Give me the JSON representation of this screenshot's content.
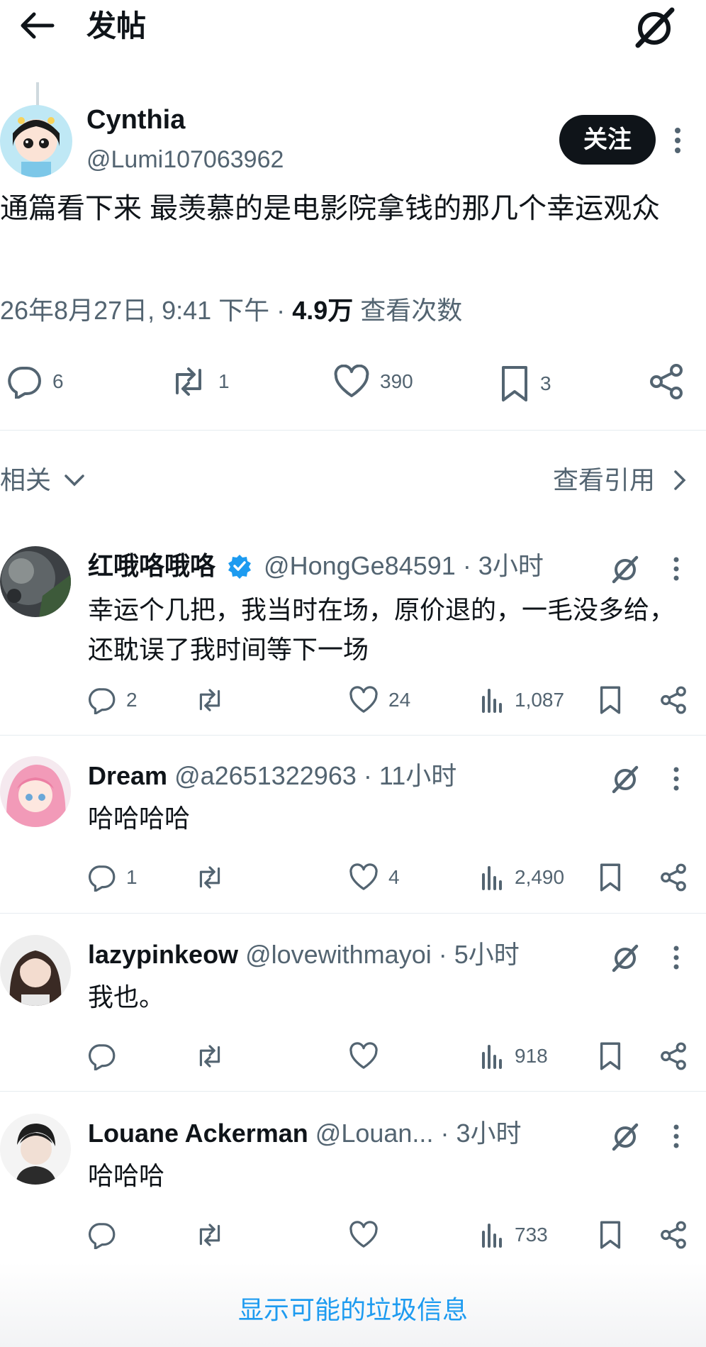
{
  "header": {
    "title": "发帖"
  },
  "post": {
    "author_name": "Cynthia",
    "author_handle": "@Lumi107063962",
    "follow_label": "关注",
    "text": "通篇看下来 最羡慕的是电影院拿钱的那几个幸运观众",
    "time": "26年8月27日, 9:41 下午 · ",
    "views": "4.9万",
    "views_label": " 查看次数",
    "replies": "6",
    "reposts": "1",
    "likes": "390",
    "bookmarks": "3"
  },
  "section": {
    "related_label": "相关",
    "quotes_label": "查看引用"
  },
  "replies": [
    {
      "name": "红哦咯哦咯",
      "handle": "@HongGe84591",
      "time": "· 3小时",
      "verified": true,
      "text": "幸运个几把，我当时在场，原价退的，一毛没多给，还耽误了我时间等下一场",
      "replies": "2",
      "reposts": "",
      "likes": "24",
      "views": "1,087"
    },
    {
      "name": "Dream",
      "handle": "@a2651322963",
      "time": "· 11小时",
      "verified": false,
      "text": "哈哈哈哈",
      "replies": "1",
      "reposts": "",
      "likes": "4",
      "views": "2,490"
    },
    {
      "name": "lazypinkeow",
      "handle": "@lovewithmayoi",
      "time": "· 5小时",
      "verified": false,
      "text": "我也。",
      "replies": "",
      "reposts": "",
      "likes": "",
      "views": "918"
    },
    {
      "name": "Louane Ackerman",
      "handle": "@Louan...",
      "time": " · 3小时",
      "verified": false,
      "text": "哈哈哈",
      "replies": "",
      "reposts": "",
      "likes": "",
      "views": "733"
    }
  ],
  "footer": {
    "spam_label": "显示可能的垃圾信息"
  },
  "colors": {
    "text": "#0f1419",
    "secondary": "#536471",
    "link": "#1d9bf0",
    "verified": "#1d9bf0"
  }
}
